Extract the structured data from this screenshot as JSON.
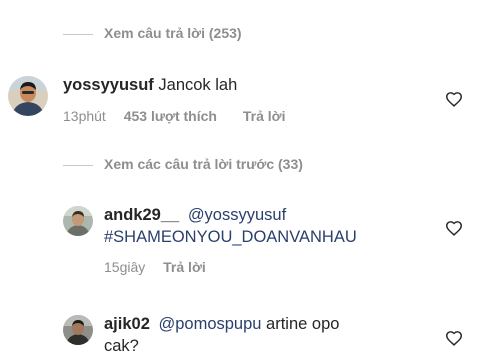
{
  "replies_top": {
    "label": "Xem câu trả lời (253)"
  },
  "comment1": {
    "username": "yossyyusuf",
    "text": "Jancok lah",
    "time": "13phút",
    "likes": "453 lượt thích",
    "reply": "Trả lời"
  },
  "replies_previous": {
    "label": "Xem các câu trả lời trước (33)"
  },
  "comment2": {
    "username": "andk29__",
    "mention": "@yossyyusuf",
    "hashtag": "#SHAMEONYOU_DOANVANHAU",
    "time": "15giây",
    "reply": "Trả lời"
  },
  "comment3": {
    "username": "ajik02",
    "mention": "@pomospupu",
    "text_line1": "artine opo",
    "text_line2": "cak?"
  },
  "icons": {
    "like": "heart-outline-icon"
  }
}
